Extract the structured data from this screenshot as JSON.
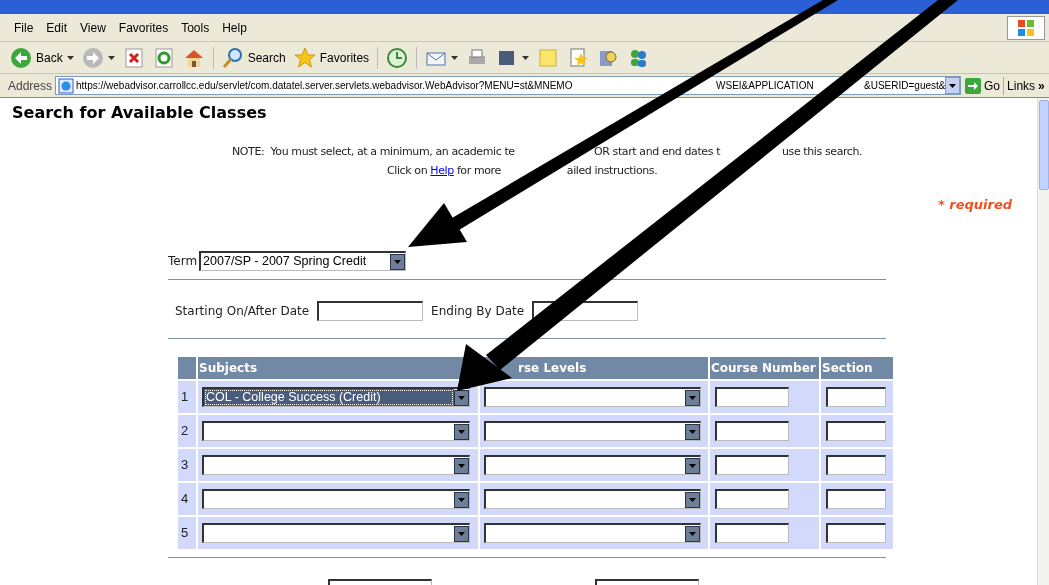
{
  "menu": [
    "File",
    "Edit",
    "View",
    "Favorites",
    "Tools",
    "Help"
  ],
  "toolbar": [
    {
      "kind": "back",
      "label": "Back",
      "dropdown": true
    },
    {
      "kind": "forward",
      "dropdown": true
    },
    {
      "kind": "stop"
    },
    {
      "kind": "refresh"
    },
    {
      "kind": "home"
    },
    {
      "kind": "search",
      "label": "Search"
    },
    {
      "kind": "favorites",
      "label": "Favorites"
    },
    {
      "kind": "history"
    },
    {
      "kind": "mail",
      "dropdown": true
    },
    {
      "kind": "print"
    },
    {
      "kind": "square",
      "dropdown": true
    },
    {
      "kind": "note"
    },
    {
      "kind": "star_page"
    },
    {
      "kind": "research"
    },
    {
      "kind": "people"
    }
  ],
  "address": {
    "label": "Address",
    "url_parts": [
      "https://webadvisor.carrollcc.edu/servlet/com.datatel.server.servlets.webadvisor.WebAdvisor?MENU=st&MNEMO",
      "WSEI&APPLICATION",
      "&USERID=guest&"
    ],
    "go": "Go",
    "links": "Links",
    "more": "»"
  },
  "page": {
    "heading": "Search for Available Classes",
    "note_line_1": [
      "NOTE:  You must select, at a minimum, an academic te",
      "OR start and end dates t",
      "use this search."
    ],
    "note_line_2": {
      "before": "Click on ",
      "link": "Help",
      "after": " for more",
      "tail": "ailed instructions."
    },
    "required": "* required",
    "term": {
      "label": "Term",
      "value": "2007/SP - 2007 Spring Credit"
    },
    "start_date": {
      "label": "Starting On/After Date"
    },
    "end_date": {
      "label": "Ending By Date"
    },
    "table": {
      "columns": [
        "Subjects",
        "rse Levels",
        "Course Number",
        "Section"
      ],
      "rows": [
        {
          "number": "1",
          "subject": "COL - College Success (Credit)",
          "focused": true
        },
        {
          "number": "2",
          "focused": false
        },
        {
          "number": "3",
          "focused": false
        },
        {
          "number": "4",
          "focused": false
        },
        {
          "number": "5",
          "focused": false
        }
      ]
    }
  }
}
